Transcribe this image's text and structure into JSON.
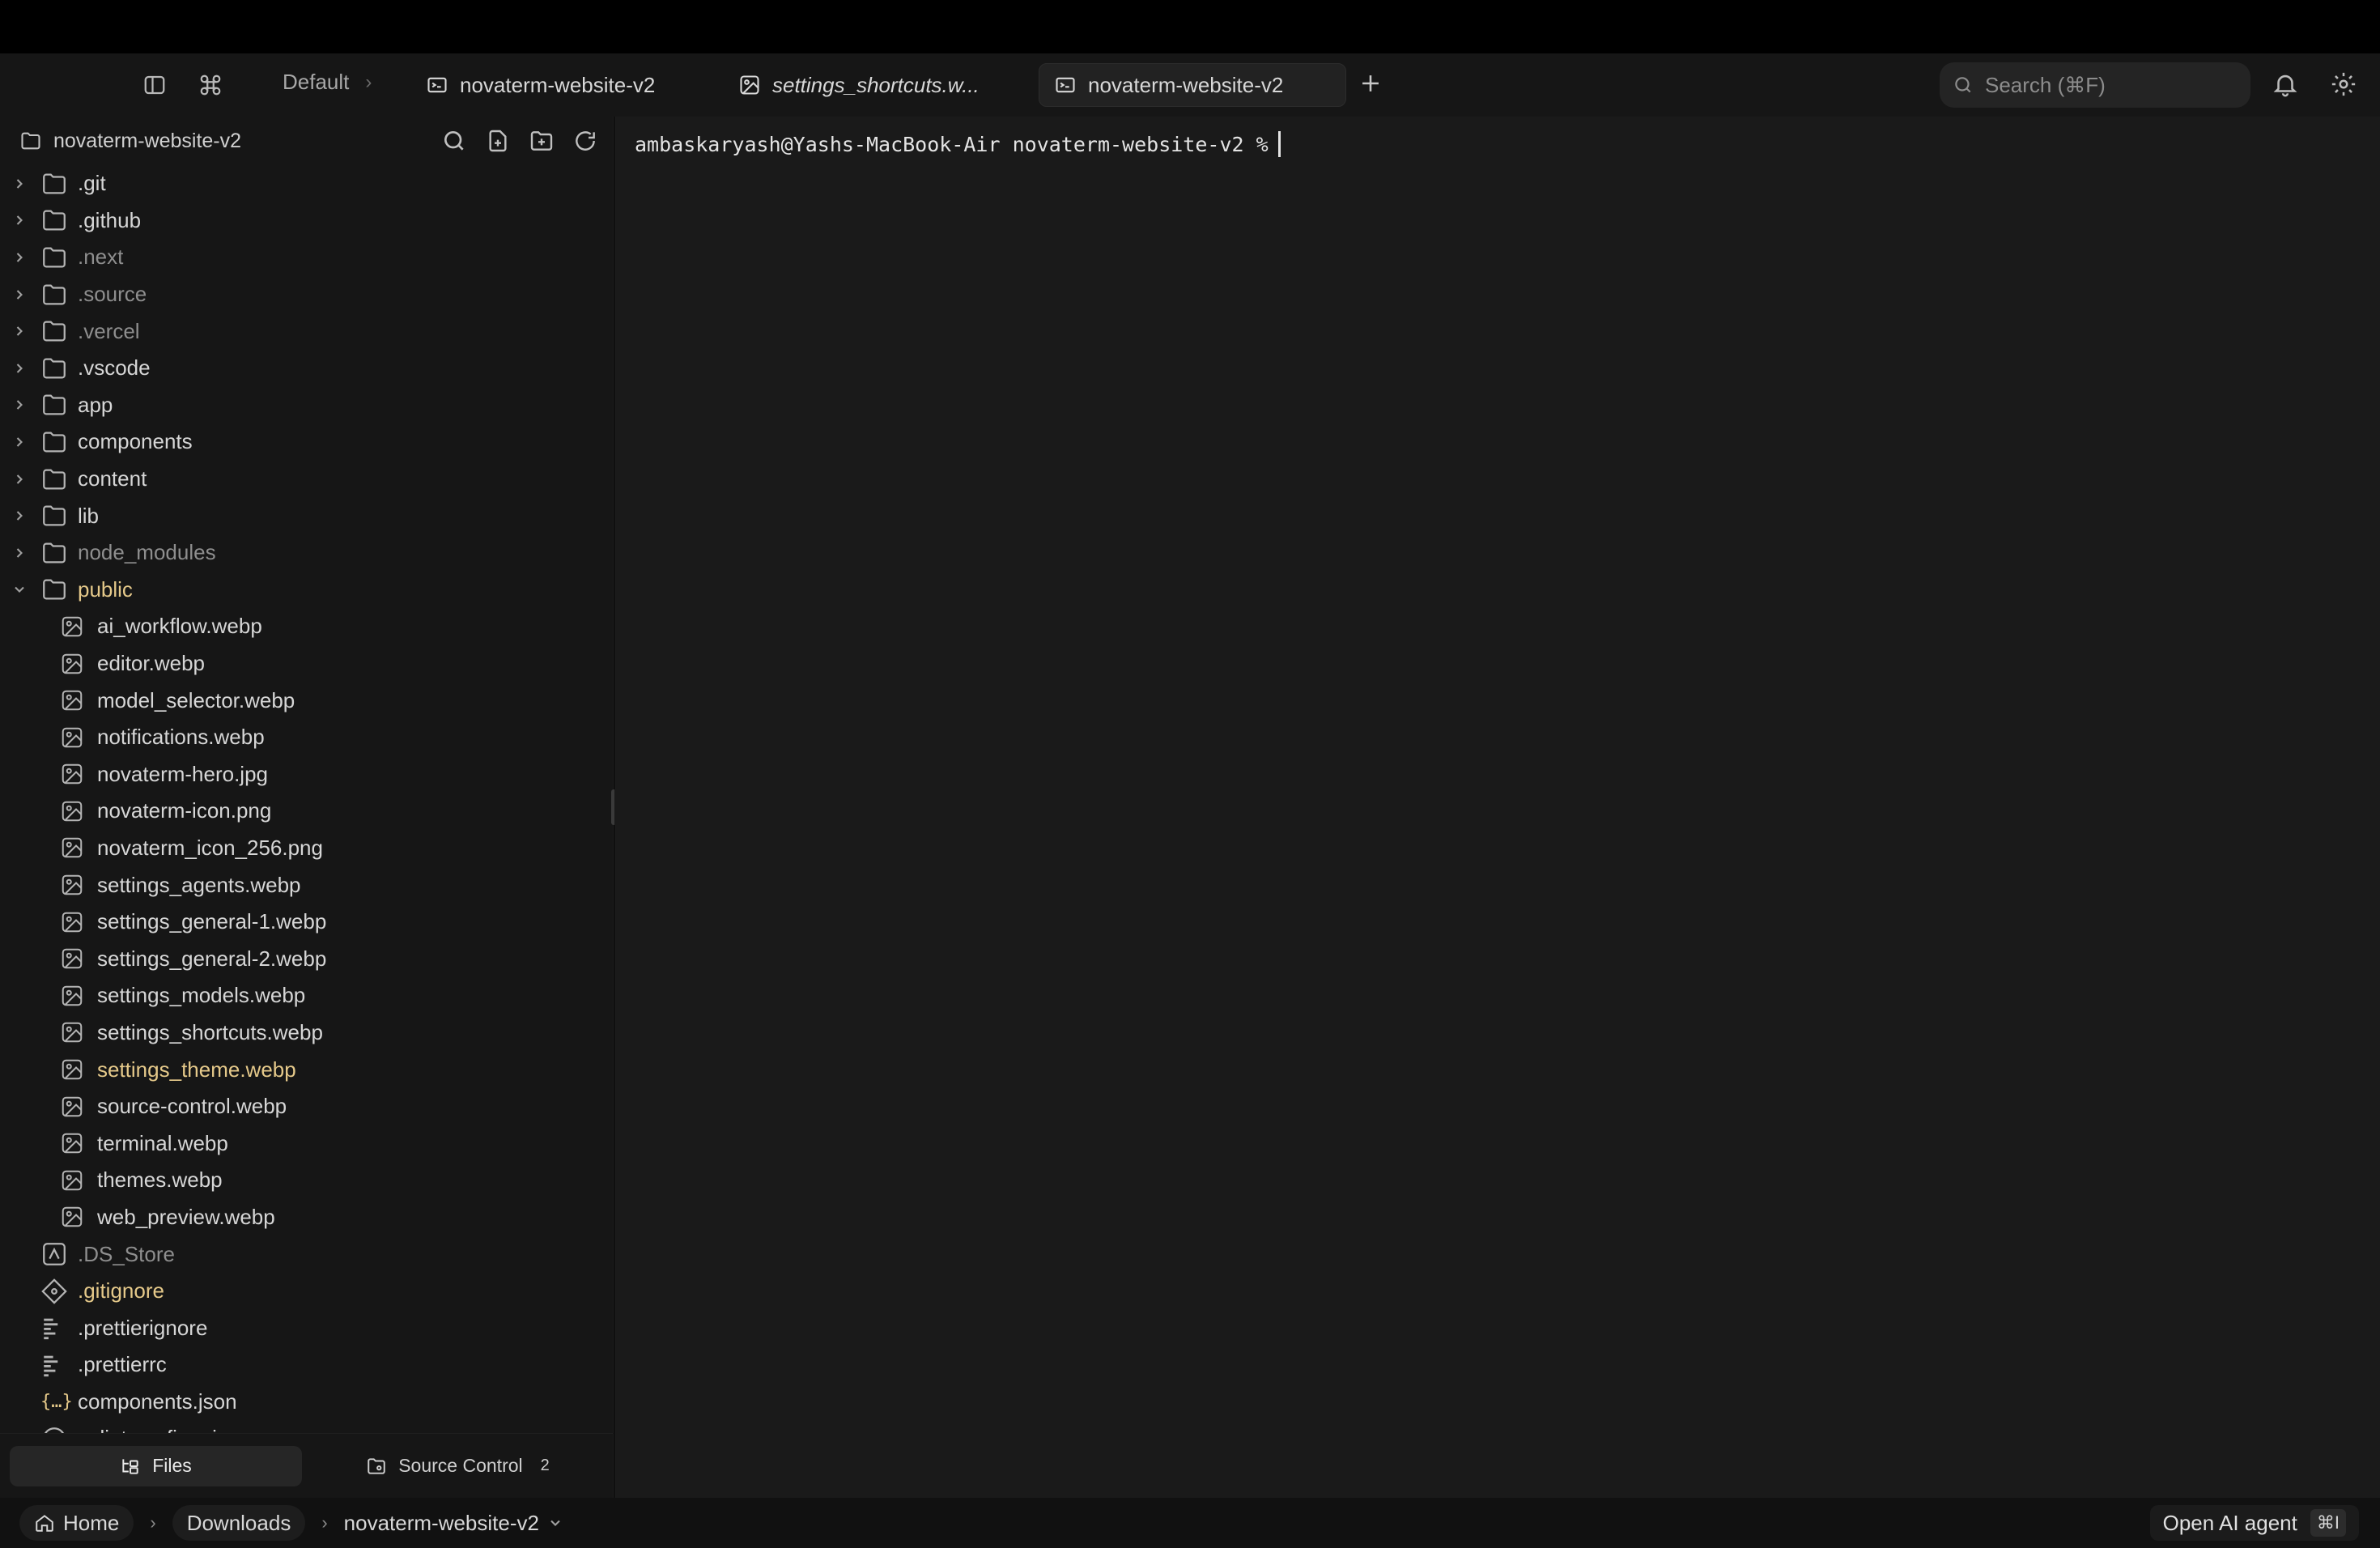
{
  "tabbar": {
    "breadcrumb": "Default",
    "tabs": [
      {
        "label": "novaterm-website-v2",
        "icon": "terminal-icon",
        "active": false
      },
      {
        "label": "settings_shortcuts.w...",
        "icon": "image-icon",
        "active": false
      },
      {
        "label": "novaterm-website-v2",
        "icon": "terminal-icon",
        "active": true
      }
    ],
    "search_placeholder": "Search (⌘F)"
  },
  "sidebar": {
    "root": "novaterm-website-v2",
    "folders": [
      {
        "label": ".git",
        "dim": false
      },
      {
        "label": ".github",
        "dim": false
      },
      {
        "label": ".next",
        "dim": true
      },
      {
        "label": ".source",
        "dim": true
      },
      {
        "label": ".vercel",
        "dim": true
      },
      {
        "label": ".vscode",
        "dim": false
      },
      {
        "label": "app",
        "dim": false
      },
      {
        "label": "components",
        "dim": false
      },
      {
        "label": "content",
        "dim": false
      },
      {
        "label": "lib",
        "dim": false
      },
      {
        "label": "node_modules",
        "dim": true
      },
      {
        "label": "public",
        "dim": false
      }
    ],
    "public_files": [
      "ai_workflow.webp",
      "editor.webp",
      "model_selector.webp",
      "notifications.webp",
      "novaterm-hero.jpg",
      "novaterm-icon.png",
      "novaterm_icon_256.png",
      "settings_agents.webp",
      "settings_general-1.webp",
      "settings_general-2.webp",
      "settings_models.webp",
      "settings_shortcuts.webp",
      "settings_theme.webp",
      "source-control.webp",
      "terminal.webp",
      "themes.webp",
      "web_preview.webp"
    ],
    "root_files": [
      ".DS_Store",
      ".gitignore",
      ".prettierignore",
      ".prettierrc",
      "components.json",
      "eslint.config.mjs"
    ],
    "tabs": {
      "files": "Files",
      "source_control": "Source Control",
      "source_control_count": "2"
    }
  },
  "terminal": {
    "prompt": "ambaskaryash@Yashs-MacBook-Air novaterm-website-v2 %"
  },
  "statusbar": {
    "home": "Home",
    "downloads": "Downloads",
    "project": "novaterm-website-v2",
    "ai_agent": "Open AI agent",
    "ai_shortcut": "⌘I"
  },
  "colors": {
    "accent_gold": "#e5c98a",
    "background": "#161616",
    "terminal_bg": "#1a1a1a"
  }
}
